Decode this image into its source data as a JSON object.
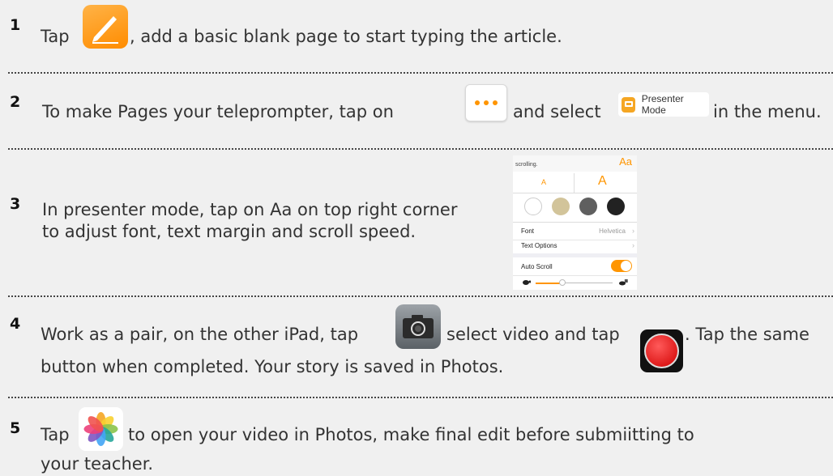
{
  "steps": [
    {
      "number": "1",
      "text_before": "Tap",
      "text_after": ", add a basic blank page to start typing the article."
    },
    {
      "number": "2",
      "text_before": "To make Pages your teleprompter, tap on",
      "text_middle": "and select",
      "text_after": "in the menu."
    },
    {
      "number": "3",
      "line1": "In presenter mode, tap on Aa on top right corner",
      "line2": "to adjust font, text margin and scroll speed."
    },
    {
      "number": "4",
      "line1_before": "Work as a pair, on the other iPad, tap",
      "line1_middle": "select video and tap",
      "line1_after": ". Tap the same",
      "line2": "button when completed. Your story is saved in Photos."
    },
    {
      "number": "5",
      "line1_before": "Tap",
      "line1_after": "to open your video in Photos, make final edit before submiitting to",
      "line2": "your teacher."
    }
  ],
  "presenter_chip": {
    "label": "Presenter Mode"
  },
  "settings_panel": {
    "header_left": "scrolling.",
    "header_right": "Aa",
    "size_small": "A",
    "size_large": "A",
    "theme_colors": [
      "#ffffff",
      "#d2c49a",
      "#5f5f5f",
      "#222222"
    ],
    "font_label": "Font",
    "font_value": "Helvetica",
    "text_options_label": "Text Options",
    "auto_scroll_label": "Auto Scroll",
    "auto_scroll_on": true,
    "scroll_speed": 0.35
  },
  "icons": {
    "step1": "pages-app-icon",
    "step2_more": "more-icon",
    "step2_chip": "presenter-mode-icon",
    "step4_camera": "camera-app-icon",
    "step4_record": "record-icon",
    "step5": "photos-app-icon"
  },
  "colors": {
    "accent": "#ff9500",
    "text": "#333333",
    "background": "#f0f0f0"
  }
}
